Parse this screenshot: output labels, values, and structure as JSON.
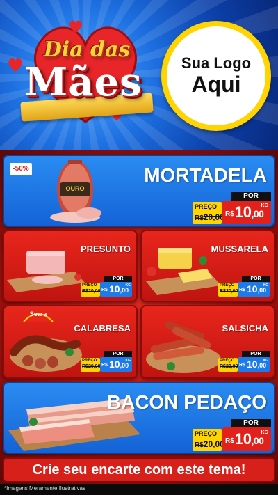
{
  "header": {
    "title_line1": "Dia das",
    "title_line2": "Mães",
    "logo_line1": "Sua Logo",
    "logo_line2": "Aqui"
  },
  "products": [
    {
      "name": "MORTADELA",
      "badge": "-50%",
      "brand": "OURO",
      "por": "POR",
      "preco_label": "PREÇO",
      "old_currency": "R$",
      "old_price": "20,00",
      "currency": "R$",
      "price_int": "10",
      "price_dec": ",00",
      "unit": "KG"
    },
    {
      "name": "PRESUNTO",
      "por": "POR",
      "preco_label": "PREÇO",
      "old_currency": "R$",
      "old_price": "20,00",
      "currency": "R$",
      "price_int": "10",
      "price_dec": ",00",
      "unit": "KG"
    },
    {
      "name": "MUSSARELA",
      "por": "POR",
      "preco_label": "PREÇO",
      "old_currency": "R$",
      "old_price": "20,00",
      "currency": "R$",
      "price_int": "10",
      "price_dec": ",00",
      "unit": "KG"
    },
    {
      "name": "CALABRESA",
      "brand": "Seara",
      "por": "POR",
      "preco_label": "PREÇO",
      "old_currency": "R$",
      "old_price": "20,00",
      "currency": "R$",
      "price_int": "10",
      "price_dec": ",00",
      "unit": "KG"
    },
    {
      "name": "SALSICHA",
      "por": "POR",
      "preco_label": "PREÇO",
      "old_currency": "R$",
      "old_price": "20,00",
      "currency": "R$",
      "price_int": "10",
      "price_dec": ",00",
      "unit": "KG"
    },
    {
      "name": "BACON PEDAÇO",
      "por": "POR",
      "preco_label": "PREÇO",
      "old_currency": "R$",
      "old_price": "20,00",
      "currency": "R$",
      "price_int": "10",
      "price_dec": ",00",
      "unit": "KG"
    }
  ],
  "footer": {
    "banner": "Crie seu encarte com este tema!",
    "disclaimer": "*Imagens Meramente Ilustrativas"
  },
  "colors": {
    "blue_card": "#1e7ae8",
    "red_card": "#e2221a",
    "yellow": "#ffd400"
  }
}
